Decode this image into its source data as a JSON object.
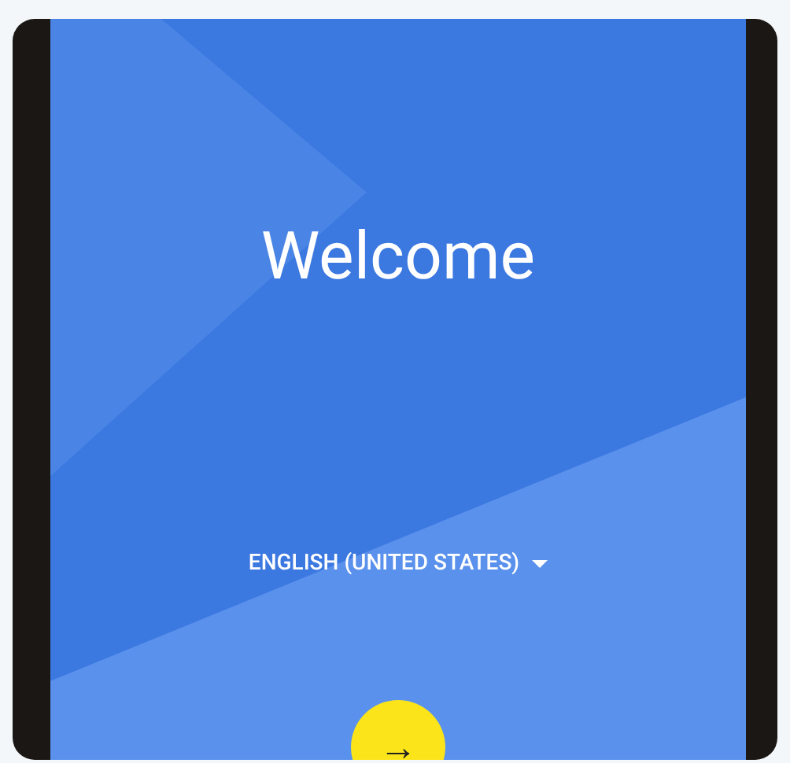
{
  "screen": {
    "title": "Welcome",
    "language": {
      "label": "ENGLISH (UNITED STATES)"
    },
    "next_button": {
      "label": "→"
    }
  }
}
